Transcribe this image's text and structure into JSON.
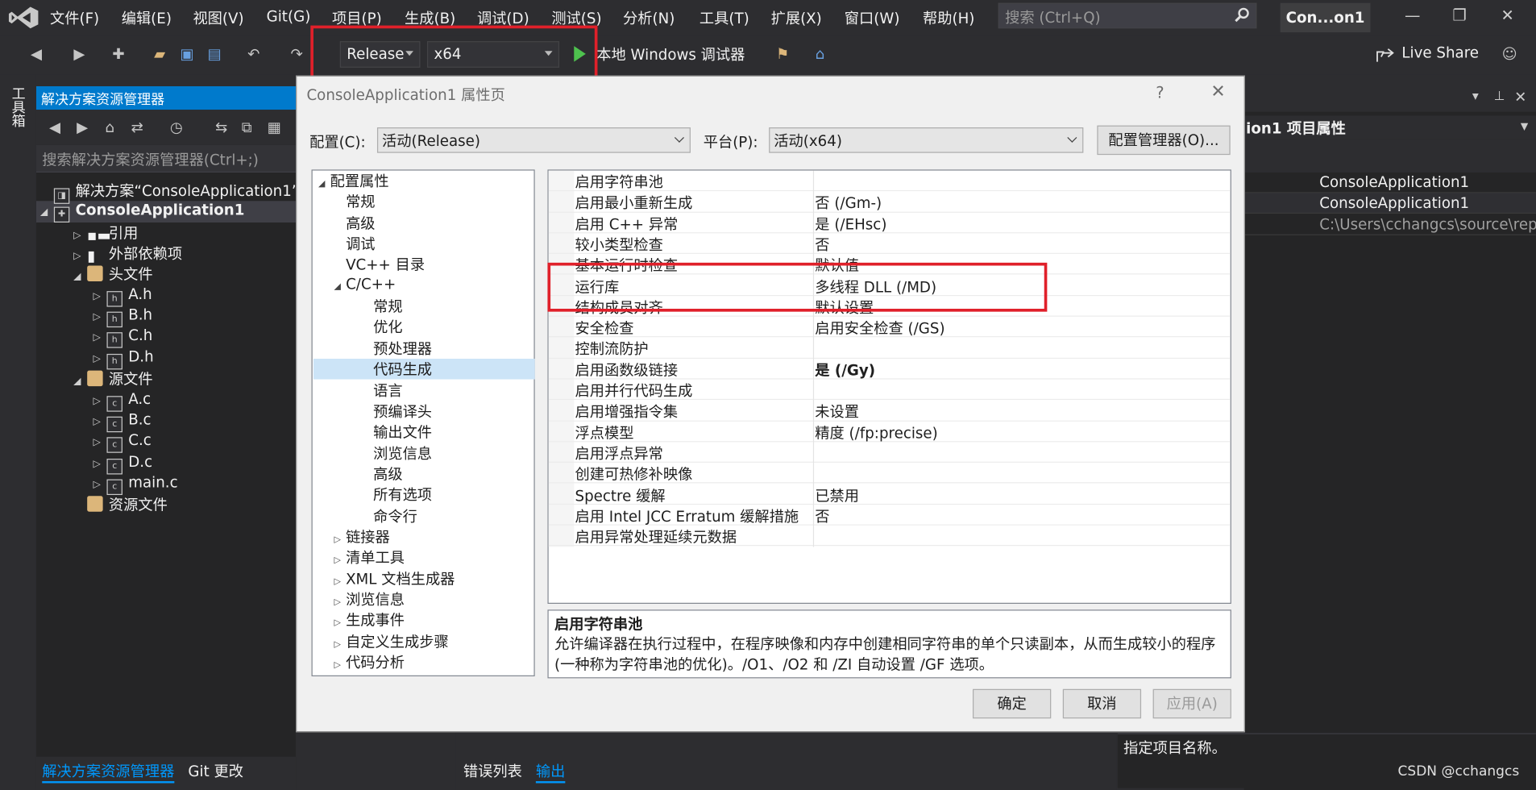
{
  "menubar": {
    "items": [
      "文件(F)",
      "编辑(E)",
      "视图(V)",
      "Git(G)",
      "项目(P)",
      "生成(B)",
      "调试(D)",
      "测试(S)",
      "分析(N)",
      "工具(T)",
      "扩展(X)",
      "窗口(W)",
      "帮助(H)"
    ],
    "search_placeholder": "搜索 (Ctrl+Q)",
    "title_badge": "Con...on1"
  },
  "toolbar": {
    "configuration": "Release",
    "platform": "x64",
    "run_label": "本地 Windows 调试器",
    "live_share": "Live Share"
  },
  "toolbox": {
    "label": "工具箱"
  },
  "solution_explorer": {
    "title": "解决方案资源管理器",
    "search_placeholder": "搜索解决方案资源管理器(Ctrl+;)",
    "tree": [
      {
        "label": "解决方案“ConsoleApplication1”(",
        "level": 0,
        "kind": "solution",
        "exp": ""
      },
      {
        "label": "ConsoleApplication1",
        "level": 0,
        "kind": "project",
        "exp": "◢",
        "bold": true
      },
      {
        "label": "引用",
        "level": 1,
        "kind": "ref",
        "exp": "▷"
      },
      {
        "label": "外部依赖项",
        "level": 1,
        "kind": "ext",
        "exp": "▷"
      },
      {
        "label": "头文件",
        "level": 1,
        "kind": "folder",
        "exp": "◢"
      },
      {
        "label": "A.h",
        "level": 2,
        "kind": "h",
        "exp": "▷"
      },
      {
        "label": "B.h",
        "level": 2,
        "kind": "h",
        "exp": "▷"
      },
      {
        "label": "C.h",
        "level": 2,
        "kind": "h",
        "exp": "▷"
      },
      {
        "label": "D.h",
        "level": 2,
        "kind": "h",
        "exp": "▷"
      },
      {
        "label": "源文件",
        "level": 1,
        "kind": "folder",
        "exp": "◢"
      },
      {
        "label": "A.c",
        "level": 2,
        "kind": "c",
        "exp": "▷"
      },
      {
        "label": "B.c",
        "level": 2,
        "kind": "c",
        "exp": "▷"
      },
      {
        "label": "C.c",
        "level": 2,
        "kind": "c",
        "exp": "▷"
      },
      {
        "label": "D.c",
        "level": 2,
        "kind": "c",
        "exp": "▷"
      },
      {
        "label": "main.c",
        "level": 2,
        "kind": "c",
        "exp": "▷"
      },
      {
        "label": "资源文件",
        "level": 1,
        "kind": "folder",
        "exp": ""
      }
    ],
    "bottom_tabs": [
      "解决方案资源管理器",
      "Git 更改"
    ]
  },
  "bottom_panel": {
    "tabs": [
      "错误列表",
      "输出"
    ]
  },
  "right_panel": {
    "header": "ion1  项目属性",
    "rows": [
      {
        "value": "ConsoleApplication1",
        "muted": false
      },
      {
        "value": "ConsoleApplication1",
        "muted": false
      },
      {
        "value": "C:\\Users\\cchangcs\\source\\repo",
        "muted": true
      }
    ],
    "description": "指定项目名称。"
  },
  "dialog": {
    "title": "ConsoleApplication1 属性页",
    "help": "?",
    "close": "✕",
    "config_label": "配置(C):",
    "config_value": "活动(Release)",
    "platform_label": "平台(P):",
    "platform_value": "活动(x64)",
    "config_manager": "配置管理器(O)...",
    "tree": [
      {
        "label": "配置属性",
        "level": 0,
        "exp": "◢"
      },
      {
        "label": "常规",
        "level": 1,
        "exp": ""
      },
      {
        "label": "高级",
        "level": 1,
        "exp": ""
      },
      {
        "label": "调试",
        "level": 1,
        "exp": ""
      },
      {
        "label": "VC++ 目录",
        "level": 1,
        "exp": ""
      },
      {
        "label": "C/C++",
        "level": 1,
        "exp": "◢"
      },
      {
        "label": "常规",
        "level": 2,
        "exp": ""
      },
      {
        "label": "优化",
        "level": 2,
        "exp": ""
      },
      {
        "label": "预处理器",
        "level": 2,
        "exp": ""
      },
      {
        "label": "代码生成",
        "level": 2,
        "exp": "",
        "selected": true
      },
      {
        "label": "语言",
        "level": 2,
        "exp": ""
      },
      {
        "label": "预编译头",
        "level": 2,
        "exp": ""
      },
      {
        "label": "输出文件",
        "level": 2,
        "exp": ""
      },
      {
        "label": "浏览信息",
        "level": 2,
        "exp": ""
      },
      {
        "label": "高级",
        "level": 2,
        "exp": ""
      },
      {
        "label": "所有选项",
        "level": 2,
        "exp": ""
      },
      {
        "label": "命令行",
        "level": 2,
        "exp": ""
      },
      {
        "label": "链接器",
        "level": 1,
        "exp": "▷"
      },
      {
        "label": "清单工具",
        "level": 1,
        "exp": "▷"
      },
      {
        "label": "XML 文档生成器",
        "level": 1,
        "exp": "▷"
      },
      {
        "label": "浏览信息",
        "level": 1,
        "exp": "▷"
      },
      {
        "label": "生成事件",
        "level": 1,
        "exp": "▷"
      },
      {
        "label": "自定义生成步骤",
        "level": 1,
        "exp": "▷"
      },
      {
        "label": "代码分析",
        "level": 1,
        "exp": "▷"
      }
    ],
    "properties": [
      {
        "name": "启用字符串池",
        "value": ""
      },
      {
        "name": "启用最小重新生成",
        "value": "否 (/Gm-)"
      },
      {
        "name": "启用 C++ 异常",
        "value": "是 (/EHsc)"
      },
      {
        "name": "较小类型检查",
        "value": "否"
      },
      {
        "name": "基本运行时检查",
        "value": "默认值"
      },
      {
        "name": "运行库",
        "value": "多线程 DLL (/MD)"
      },
      {
        "name": "结构成员对齐",
        "value": "默认设置"
      },
      {
        "name": "安全检查",
        "value": "启用安全检查 (/GS)"
      },
      {
        "name": "控制流防护",
        "value": ""
      },
      {
        "name": "启用函数级链接",
        "value": "是 (/Gy)",
        "bold": true
      },
      {
        "name": "启用并行代码生成",
        "value": ""
      },
      {
        "name": "启用增强指令集",
        "value": "未设置"
      },
      {
        "name": "浮点模型",
        "value": "精度 (/fp:precise)"
      },
      {
        "name": "启用浮点异常",
        "value": ""
      },
      {
        "name": "创建可热修补映像",
        "value": ""
      },
      {
        "name": "Spectre 缓解",
        "value": "已禁用"
      },
      {
        "name": "启用 Intel JCC Erratum 缓解措施",
        "value": "否"
      },
      {
        "name": "启用异常处理延续元数据",
        "value": ""
      }
    ],
    "description_title": "启用字符串池",
    "description_body": "允许编译器在执行过程中，在程序映像和内存中创建相同字符串的单个只读副本，从而生成较小的程序(一种称为字符串池的优化)。/O1、/O2 和 /ZI 自动设置 /GF 选项。",
    "ok": "确定",
    "cancel": "取消",
    "apply": "应用(A)"
  },
  "watermark": "CSDN @cchangcs",
  "colors": {
    "accent": "#007acc",
    "highlight_box": "#e0202a",
    "run_green": "#4ec24e"
  }
}
